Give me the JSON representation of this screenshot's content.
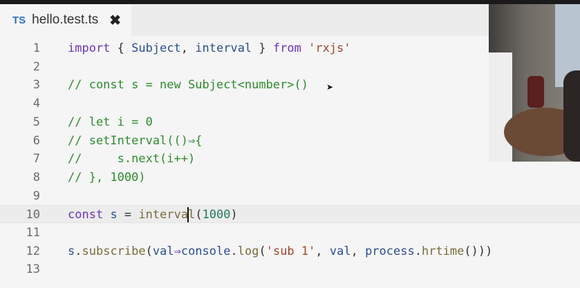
{
  "tab": {
    "badge": "TS",
    "filename": "hello.test.ts",
    "close_glyph": "✖"
  },
  "editor": {
    "current_line": 10,
    "lines": [
      {
        "n": "1",
        "tokens": [
          [
            "kw",
            "import"
          ],
          [
            "pl",
            " { "
          ],
          [
            "id",
            "Subject"
          ],
          [
            "pl",
            ", "
          ],
          [
            "id",
            "interval"
          ],
          [
            "pl",
            " } "
          ],
          [
            "kw",
            "from"
          ],
          [
            "pl",
            " "
          ],
          [
            "str",
            "'rxjs'"
          ]
        ]
      },
      {
        "n": "2",
        "tokens": []
      },
      {
        "n": "3",
        "tokens": [
          [
            "cm",
            "// const s = new Subject<number>()"
          ]
        ]
      },
      {
        "n": "4",
        "tokens": []
      },
      {
        "n": "5",
        "tokens": [
          [
            "cm",
            "// let i = 0"
          ]
        ]
      },
      {
        "n": "6",
        "tokens": [
          [
            "cm",
            "// setInterval(()⇒{"
          ]
        ]
      },
      {
        "n": "7",
        "tokens": [
          [
            "cm",
            "//     s.next(i++)"
          ]
        ]
      },
      {
        "n": "8",
        "tokens": [
          [
            "cm",
            "// }, 1000)"
          ]
        ]
      },
      {
        "n": "9",
        "tokens": []
      },
      {
        "n": "10",
        "tokens": [
          [
            "kw",
            "const"
          ],
          [
            "pl",
            " "
          ],
          [
            "id",
            "s"
          ],
          [
            "pl",
            " = "
          ],
          [
            "fn",
            "interva"
          ],
          [
            "caret",
            ""
          ],
          [
            "fn",
            "l"
          ],
          [
            "pl",
            "("
          ],
          [
            "num",
            "1000"
          ],
          [
            "pl",
            ")"
          ]
        ]
      },
      {
        "n": "11",
        "tokens": []
      },
      {
        "n": "12",
        "tokens": [
          [
            "id",
            "s"
          ],
          [
            "pl",
            "."
          ],
          [
            "fn",
            "subscribe"
          ],
          [
            "pl",
            "("
          ],
          [
            "id",
            "val"
          ],
          [
            "kw",
            "⇒"
          ],
          [
            "id",
            "console"
          ],
          [
            "pl",
            "."
          ],
          [
            "fn",
            "log"
          ],
          [
            "pl",
            "("
          ],
          [
            "str",
            "'sub 1'"
          ],
          [
            "pl",
            ", "
          ],
          [
            "id",
            "val"
          ],
          [
            "pl",
            ", "
          ],
          [
            "id",
            "process"
          ],
          [
            "pl",
            "."
          ],
          [
            "fn",
            "hrtime"
          ],
          [
            "pl",
            "()))"
          ]
        ]
      },
      {
        "n": "13",
        "tokens": []
      }
    ]
  },
  "webcam": {
    "icon": "webcam-overlay"
  }
}
